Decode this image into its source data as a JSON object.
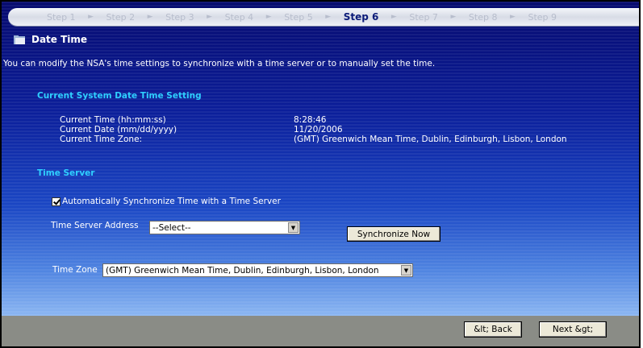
{
  "wizard": {
    "steps": [
      "Step 1",
      "Step 2",
      "Step 3",
      "Step 4",
      "Step 5",
      "Step 6",
      "Step 7",
      "Step 8",
      "Step 9"
    ],
    "active_step": "Step 6"
  },
  "page": {
    "title": "Date Time",
    "intro": "You can modify the NSA's time settings to synchronize with a time server or to manually set the time."
  },
  "current_setting": {
    "heading": "Current System Date Time Setting",
    "time_label": "Current Time (hh:mm:ss)",
    "time_value": "8:28:46",
    "date_label": "Current Date (mm/dd/yyyy)",
    "date_value": "11/20/2006",
    "zone_label": "Current Time Zone:",
    "zone_value": "(GMT) Greenwich Mean Time, Dublin, Edinburgh, Lisbon, London"
  },
  "time_server": {
    "heading": "Time Server",
    "auto_sync_label": "Automatically Synchronize Time with a Time Server",
    "auto_sync_checked": true,
    "address_label": "Time Server Address",
    "address_value": "--Select--",
    "sync_button": "Synchronize Now",
    "zone_label": "Time Zone",
    "zone_value": "(GMT) Greenwich Mean Time, Dublin, Edinburgh, Lisbon, London"
  },
  "footer": {
    "back_label": "&lt; Back",
    "next_label": "Next &gt;"
  },
  "colors": {
    "section_heading": "#2fd0ff",
    "active_step": "#0a1a78",
    "footer_bg": "#8a8c86"
  }
}
